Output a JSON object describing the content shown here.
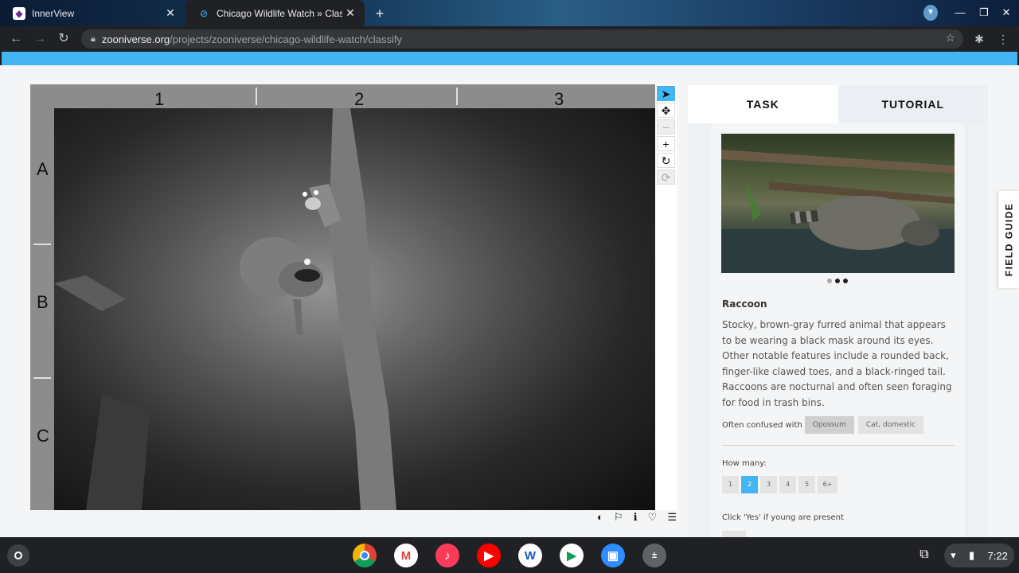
{
  "browser": {
    "tabs": [
      {
        "title": "InnerView",
        "favicon": "innerview-logo-icon"
      },
      {
        "title": "Chicago Wildlife Watch » Classi",
        "favicon": "zooniverse-logo-icon"
      }
    ],
    "url_host": "zooniverse.org",
    "url_path": "/projects/zooniverse/chicago-wildlife-watch/classify"
  },
  "viewer": {
    "columns": [
      "1",
      "2",
      "3"
    ],
    "rows": [
      "A",
      "B",
      "C"
    ]
  },
  "panel": {
    "tabs": {
      "task": "TASK",
      "tutorial": "TUTORIAL"
    },
    "species": {
      "name": "Raccoon",
      "description": "Stocky, brown-gray furred animal that appears to be wearing a black mask around its eyes. Other notable features include a rounded back, finger-like clawed toes, and a black-ringed tail. Raccoons are nocturnal and often seen foraging for food in trash bins.",
      "confused_label": "Often confused with",
      "confused_with": [
        "Opossum",
        "Cat, domestic"
      ]
    },
    "howmany_label": "How many:",
    "howmany_options": [
      "1",
      "2",
      "3",
      "4",
      "5",
      "6+"
    ],
    "howmany_selected": "2",
    "young_label": "Click 'Yes' if young are present"
  },
  "field_guide": "FIELD GUIDE",
  "shelf": {
    "time": "7:22"
  },
  "colors": {
    "accent": "#43b5f2",
    "chrome": "#202124"
  }
}
